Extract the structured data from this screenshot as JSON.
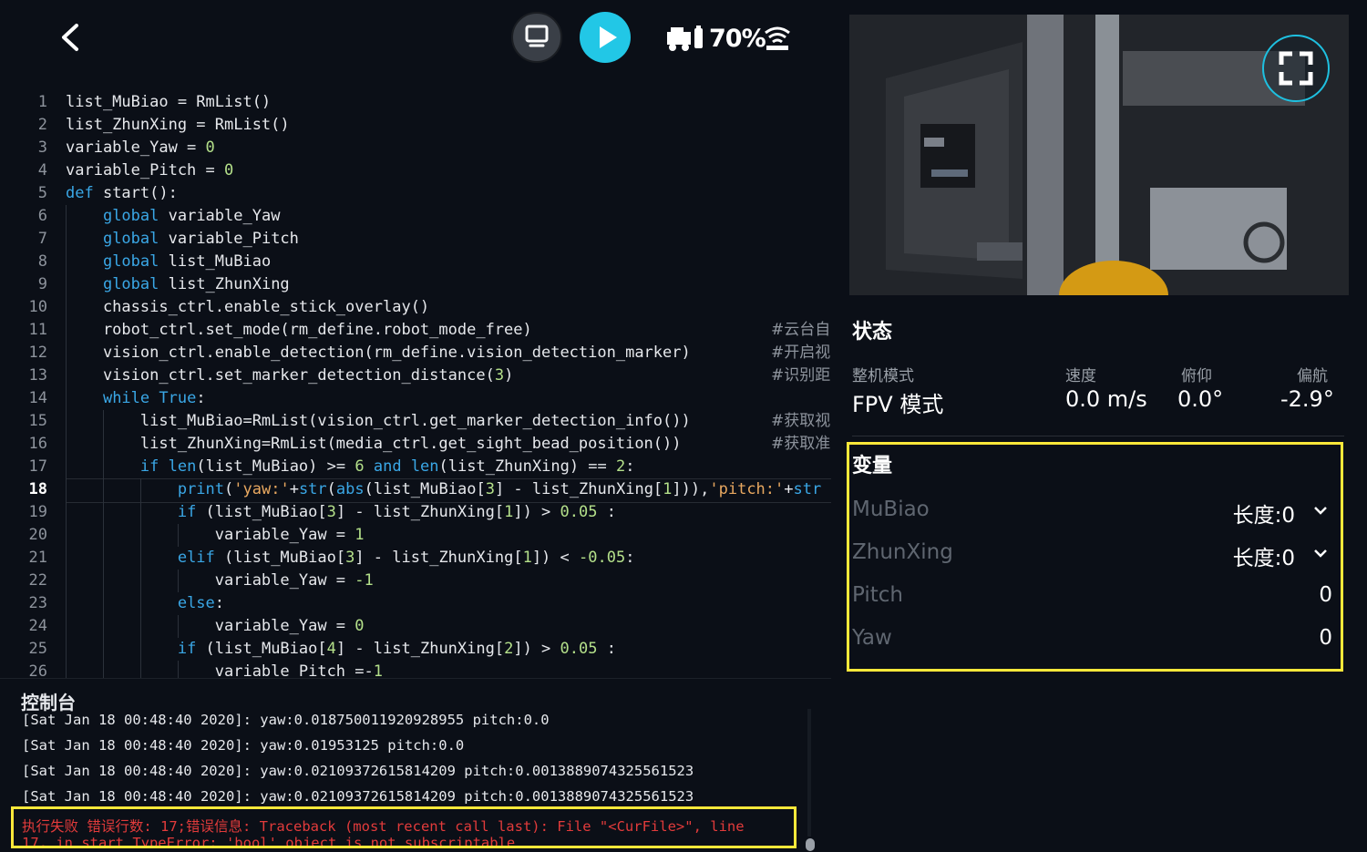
{
  "toolbar": {
    "battery": "70%"
  },
  "editor": {
    "current_line": 18,
    "lines": [
      {
        "n": "1",
        "html": "list_MuBiao = RmList()"
      },
      {
        "n": "2",
        "html": "list_ZhunXing = RmList()"
      },
      {
        "n": "3",
        "html": "variable_Yaw = <span class=\"num\">0</span>"
      },
      {
        "n": "4",
        "html": "variable_Pitch = <span class=\"num\">0</span>"
      },
      {
        "n": "5",
        "html": "<span class=\"kw\">def</span> start():"
      },
      {
        "n": "6",
        "html": "    <span class=\"kw\">global</span> variable_Yaw"
      },
      {
        "n": "7",
        "html": "    <span class=\"kw\">global</span> variable_Pitch"
      },
      {
        "n": "8",
        "html": "    <span class=\"kw\">global</span> list_MuBiao"
      },
      {
        "n": "9",
        "html": "    <span class=\"kw\">global</span> list_ZhunXing"
      },
      {
        "n": "10",
        "html": "    chassis_ctrl.enable_stick_overlay()"
      },
      {
        "n": "11",
        "html": "    robot_ctrl.set_mode(rm_define.robot_mode_free)"
      },
      {
        "n": "12",
        "html": "    vision_ctrl.enable_detection(rm_define.vision_detection_marker)"
      },
      {
        "n": "13",
        "html": "    vision_ctrl.set_marker_detection_distance(<span class=\"num\">3</span>)"
      },
      {
        "n": "14",
        "html": "    <span class=\"kw\">while</span> <span class=\"kw\">True</span>:"
      },
      {
        "n": "15",
        "html": "        list_MuBiao=RmList(vision_ctrl.get_marker_detection_info())"
      },
      {
        "n": "16",
        "html": "        list_ZhunXing=RmList(media_ctrl.get_sight_bead_position())"
      },
      {
        "n": "17",
        "html": "        <span class=\"kw\">if</span> <span class=\"kw\">len</span>(list_MuBiao) >= <span class=\"num\">6</span> <span class=\"kw\">and</span> <span class=\"kw\">len</span>(list_ZhunXing) == <span class=\"num\">2</span>:"
      },
      {
        "n": "18",
        "html": "            <span class=\"kw\">print</span>(<span class=\"str\">'yaw:'</span>+<span class=\"kw\">str</span>(<span class=\"kw\">abs</span>(list_MuBiao[<span class=\"num\">3</span>] - list_ZhunXing[<span class=\"num\">1</span>])),<span class=\"str\">'pitch:'</span>+<span class=\"kw\">str</span>"
      },
      {
        "n": "19",
        "html": "            <span class=\"kw\">if</span> (list_MuBiao[<span class=\"num\">3</span>] - list_ZhunXing[<span class=\"num\">1</span>]) > <span class=\"num\">0.05</span> :"
      },
      {
        "n": "20",
        "html": "                variable_Yaw = <span class=\"num\">1</span>"
      },
      {
        "n": "21",
        "html": "            <span class=\"kw\">elif</span> (list_MuBiao[<span class=\"num\">3</span>] - list_ZhunXing[<span class=\"num\">1</span>]) < <span class=\"num\">-0.05</span>:"
      },
      {
        "n": "22",
        "html": "                variable_Yaw = <span class=\"num\">-1</span>"
      },
      {
        "n": "23",
        "html": "            <span class=\"kw\">else</span>:"
      },
      {
        "n": "24",
        "html": "                variable_Yaw = <span class=\"num\">0</span>"
      },
      {
        "n": "25",
        "html": "            <span class=\"kw\">if</span> (list_MuBiao[<span class=\"num\">4</span>] - list_ZhunXing[<span class=\"num\">2</span>]) > <span class=\"num\">0.05</span> :"
      },
      {
        "n": "26",
        "html": "                variable_Pitch =-<span class=\"num\">1</span>"
      }
    ],
    "comments": [
      {
        "line": 11,
        "text": "#云台自"
      },
      {
        "line": 12,
        "text": "#开启视"
      },
      {
        "line": 13,
        "text": "#识别距"
      },
      {
        "line": 15,
        "text": "#获取视"
      },
      {
        "line": 16,
        "text": "#获取准"
      }
    ]
  },
  "console": {
    "title": "控制台",
    "logs": [
      "[Sat Jan 18 00:48:40 2020]: yaw:0.018750011920928955 pitch:0.0",
      "[Sat Jan 18 00:48:40 2020]: yaw:0.01953125 pitch:0.0",
      "[Sat Jan 18 00:48:40 2020]: yaw:0.02109372615814209 pitch:0.0013889074325561523",
      "[Sat Jan 18 00:48:40 2020]: yaw:0.02109372615814209 pitch:0.0013889074325561523"
    ],
    "error_line1": "执行失败 错误行数: 17;错误信息: Traceback (most recent call last): File \"<CurFile>\", line",
    "error_line2": "17, in start TypeError: 'bool' object is not subscriptable"
  },
  "status": {
    "title": "状态",
    "mode_label": "整机模式",
    "mode_value": "FPV 模式",
    "speed_label": "速度",
    "speed_value": "0.0 m/s",
    "pitch_label": "俯仰",
    "pitch_value": "0.0°",
    "yaw_label": "偏航",
    "yaw_value": "-2.9°"
  },
  "variables": {
    "title": "变量",
    "items": [
      {
        "name": "MuBiao",
        "value": "长度:0",
        "expandable": true
      },
      {
        "name": "ZhunXing",
        "value": "长度:0",
        "expandable": true
      },
      {
        "name": "Pitch",
        "value": "0",
        "expandable": false
      },
      {
        "name": "Yaw",
        "value": "0",
        "expandable": false
      }
    ]
  },
  "colors": {
    "accent": "#22c7e6",
    "highlight_box": "#ffe83a",
    "error": "#e23b3b",
    "keyword": "#3aa7e6",
    "number": "#b4e08a",
    "string": "#e8a860"
  }
}
